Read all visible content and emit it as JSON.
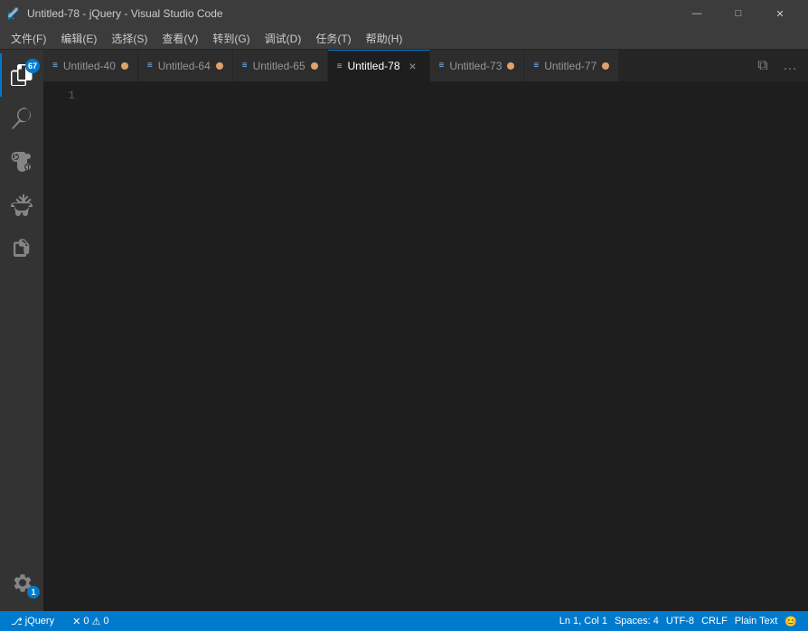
{
  "titlebar": {
    "icon": "⊞",
    "title": "Untitled-78 - jQuery - Visual Studio Code",
    "minimize": "—",
    "maximize": "□",
    "close": "✕"
  },
  "menubar": {
    "items": [
      {
        "label": "文件(F)"
      },
      {
        "label": "编辑(E)"
      },
      {
        "label": "选择(S)"
      },
      {
        "label": "查看(V)"
      },
      {
        "label": "转到(G)"
      },
      {
        "label": "调试(D)"
      },
      {
        "label": "任务(T)"
      },
      {
        "label": "帮助(H)"
      }
    ]
  },
  "activitybar": {
    "items": [
      {
        "icon": "📋",
        "badge": "67",
        "name": "explorer",
        "active": true
      },
      {
        "icon": "🔍",
        "name": "search",
        "active": false
      },
      {
        "icon": "⑂",
        "name": "source-control",
        "active": false
      },
      {
        "icon": "⊗",
        "name": "debug",
        "active": false
      },
      {
        "icon": "⊞",
        "name": "extensions",
        "active": false
      }
    ],
    "bottom": {
      "icon": "⚙",
      "badge": "1"
    }
  },
  "tabs": [
    {
      "label": "Untitled-40",
      "active": false,
      "dirty": true,
      "id": "tab-untitled-40"
    },
    {
      "label": "Untitled-64",
      "active": false,
      "dirty": true,
      "id": "tab-untitled-64"
    },
    {
      "label": "Untitled-65",
      "active": false,
      "dirty": true,
      "id": "tab-untitled-65"
    },
    {
      "label": "Untitled-78",
      "active": true,
      "dirty": false,
      "id": "tab-untitled-78"
    },
    {
      "label": "Untitled-73",
      "active": false,
      "dirty": true,
      "id": "tab-untitled-73"
    },
    {
      "label": "Untitled-77",
      "active": false,
      "dirty": true,
      "id": "tab-untitled-77"
    }
  ],
  "editor": {
    "line_number_1": "1"
  },
  "statusbar": {
    "branch": "jQuery",
    "errors": "0",
    "warnings": "0",
    "cursor": "Ln 1, Col 1",
    "spaces": "Spaces: 4",
    "encoding": "UTF-8",
    "line_ending": "CRLF",
    "language": "Plain Text",
    "feedback": "😊"
  }
}
